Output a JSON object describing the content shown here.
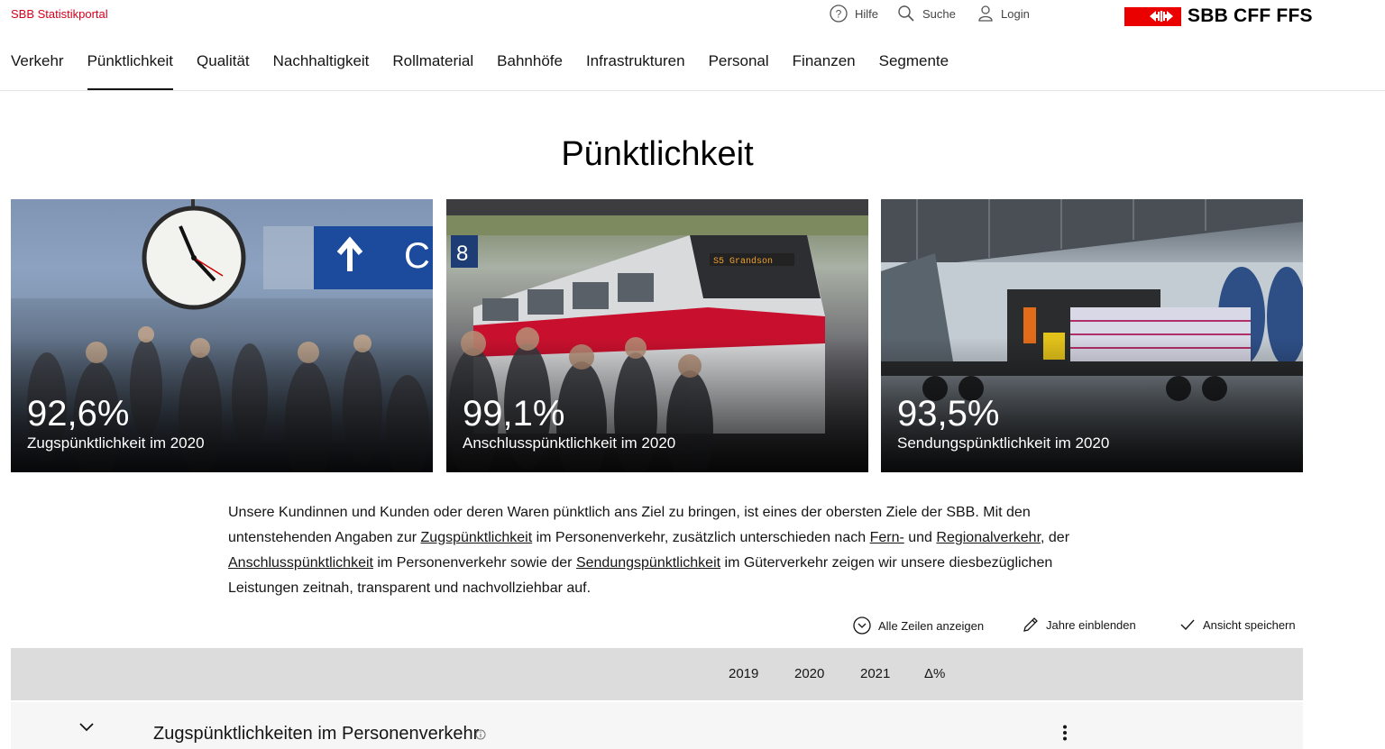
{
  "header": {
    "portal_name": "SBB Statistikportal",
    "help_label": "Hilfe",
    "search_label": "Suche",
    "login_label": "Login",
    "logo_text": "SBB CFF FFS",
    "brand_color": "#eb0000"
  },
  "nav": {
    "items": [
      "Verkehr",
      "Pünktlichkeit",
      "Qualität",
      "Nachhaltigkeit",
      "Rollmaterial",
      "Bahnhöfe",
      "Infrastrukturen",
      "Personal",
      "Finanzen",
      "Segmente"
    ],
    "active": "Pünktlichkeit"
  },
  "page": {
    "title": "Pünktlichkeit"
  },
  "tiles": [
    {
      "value": "92,6%",
      "label": "Zugspünktlichkeit im 2020"
    },
    {
      "value": "99,1%",
      "label": "Anschlusspünktlichkeit im 2020"
    },
    {
      "value": "93,5%",
      "label": "Sendungspünktlichkeit im 2020"
    }
  ],
  "tile_2_sign": "S5 Grandson",
  "tile_2_platform": "8",
  "tile_1_sign": "C",
  "intro": {
    "p1": "Unsere Kundinnen und Kunden oder deren Waren pünktlich ans Ziel zu bringen, ist eines der obersten Ziele der SBB. Mit den untenstehenden Angaben zur ",
    "link1": "Zugspünktlichkeit",
    "p2": " im Personenverkehr, zusätzlich unterschieden nach ",
    "link2": "Fern-",
    "p3": " und ",
    "link3": "Regionalverkehr",
    "p4": ", der ",
    "link4": "Anschlusspünktlichkeit",
    "p5": " im Personenverkehr sowie der ",
    "link5": "Sendungspünktlichkeit",
    "p6": " im Güterverkehr zeigen wir unsere diesbezüglichen Leistungen zeitnah, transparent und nachvollziehbar auf."
  },
  "actions": {
    "show_rows": "Alle Zeilen anzeigen",
    "show_years": "Jahre einblenden",
    "save_view": "Ansicht speichern"
  },
  "table": {
    "columns": [
      "2019",
      "2020",
      "2021",
      "Δ%"
    ],
    "rows": [
      {
        "title": "Zugspünktlichkeiten im Personenverkehr"
      }
    ]
  },
  "icons": [
    "help-icon",
    "search-icon",
    "user-icon",
    "sbb-logo-icon",
    "chevron-circle-icon",
    "pencil-icon",
    "check-icon",
    "chevron-down-icon",
    "info-icon",
    "more-vertical-icon"
  ]
}
